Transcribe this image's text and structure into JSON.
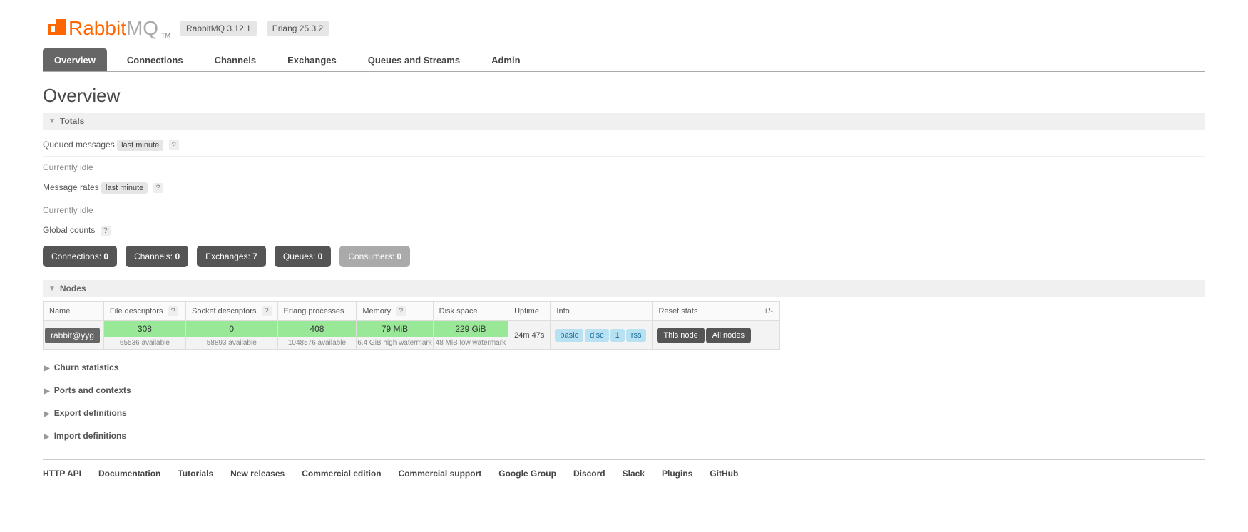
{
  "header": {
    "logo_rabbit": "Rabbit",
    "logo_mq": "MQ",
    "logo_tm": "TM",
    "version": "RabbitMQ 3.12.1",
    "erlang": "Erlang 25.3.2"
  },
  "tabs": [
    "Overview",
    "Connections",
    "Channels",
    "Exchanges",
    "Queues and Streams",
    "Admin"
  ],
  "page_title": "Overview",
  "totals": {
    "header": "Totals",
    "queued_label": "Queued messages",
    "queued_range": "last minute",
    "idle1": "Currently idle",
    "rates_label": "Message rates",
    "rates_range": "last minute",
    "idle2": "Currently idle",
    "global_label": "Global counts"
  },
  "counts": [
    {
      "label": "Connections:",
      "value": "0",
      "muted": false
    },
    {
      "label": "Channels:",
      "value": "0",
      "muted": false
    },
    {
      "label": "Exchanges:",
      "value": "7",
      "muted": false
    },
    {
      "label": "Queues:",
      "value": "0",
      "muted": false
    },
    {
      "label": "Consumers:",
      "value": "0",
      "muted": true
    }
  ],
  "nodes": {
    "header": "Nodes",
    "columns": [
      "Name",
      "File descriptors",
      "Socket descriptors",
      "Erlang processes",
      "Memory",
      "Disk space",
      "Uptime",
      "Info",
      "Reset stats",
      "+/-"
    ],
    "help_cols": [
      1,
      2,
      4
    ],
    "row": {
      "name": "rabbit@yyg",
      "fd": {
        "value": "308",
        "sub": "65536 available"
      },
      "sd": {
        "value": "0",
        "sub": "58893 available"
      },
      "ep": {
        "value": "408",
        "sub": "1048576 available"
      },
      "mem": {
        "value": "79 MiB",
        "sub": "6.4 GiB high watermark"
      },
      "disk": {
        "value": "229 GiB",
        "sub": "48 MiB low watermark"
      },
      "uptime": "24m 47s",
      "info_badges": [
        "basic",
        "disc",
        "1",
        "rss"
      ],
      "reset_this": "This node",
      "reset_all": "All nodes"
    }
  },
  "collapsed_sections": [
    "Churn statistics",
    "Ports and contexts",
    "Export definitions",
    "Import definitions"
  ],
  "footer": [
    "HTTP API",
    "Documentation",
    "Tutorials",
    "New releases",
    "Commercial edition",
    "Commercial support",
    "Google Group",
    "Discord",
    "Slack",
    "Plugins",
    "GitHub"
  ]
}
